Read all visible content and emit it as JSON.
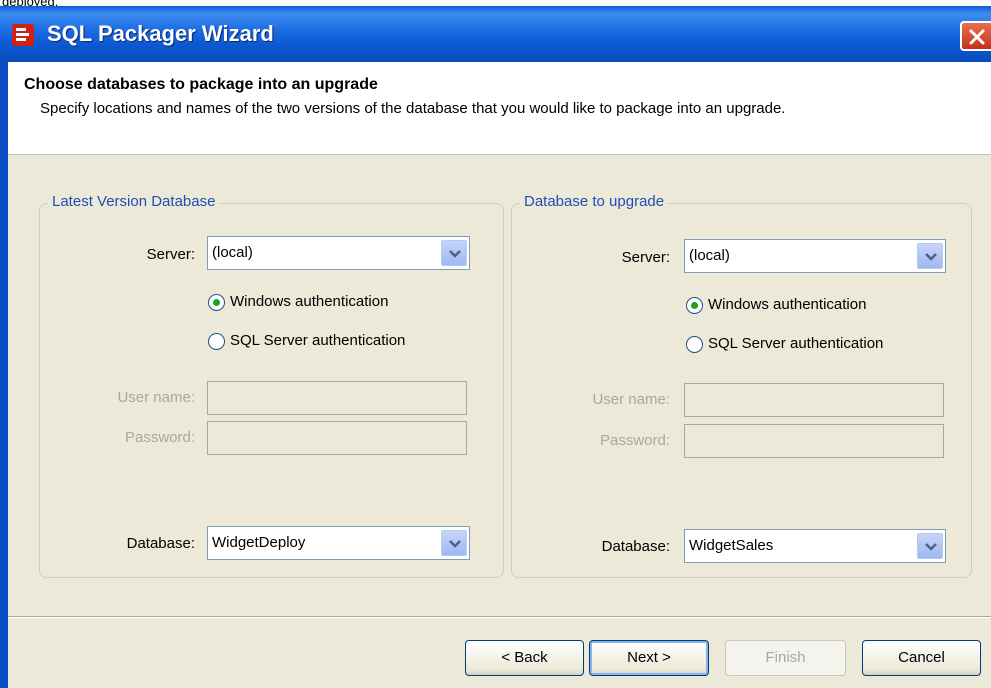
{
  "caption": "deployed.",
  "window": {
    "title": "SQL Packager Wizard",
    "icons": {
      "app": "sql-packager-icon",
      "close": "close-icon"
    }
  },
  "header": {
    "title": "Choose databases to package into an upgrade",
    "description": "Specify locations and names of the two versions of the database that you would like to package into an upgrade."
  },
  "latest": {
    "group_title": "Latest Version Database",
    "server_label": "Server:",
    "server_value": "(local)",
    "windows_auth": "Windows authentication",
    "sql_auth": "SQL Server authentication",
    "selected_auth": "windows",
    "user_label": "User name:",
    "password_label": "Password:",
    "database_label": "Database:",
    "database_value": "WidgetDeploy"
  },
  "upgrade": {
    "group_title": "Database to upgrade",
    "server_label": "Server:",
    "server_value": "(local)",
    "windows_auth": "Windows authentication",
    "sql_auth": "SQL Server authentication",
    "selected_auth": "windows",
    "user_label": "User name:",
    "password_label": "Password:",
    "database_label": "Database:",
    "database_value": "WidgetSales"
  },
  "buttons": {
    "back": "< Back",
    "next": "Next >",
    "finish": "Finish",
    "cancel": "Cancel"
  },
  "colors": {
    "titlebar": "#0b58d0",
    "group_title": "#1f4eb5",
    "radio_selected": "#21a121"
  }
}
